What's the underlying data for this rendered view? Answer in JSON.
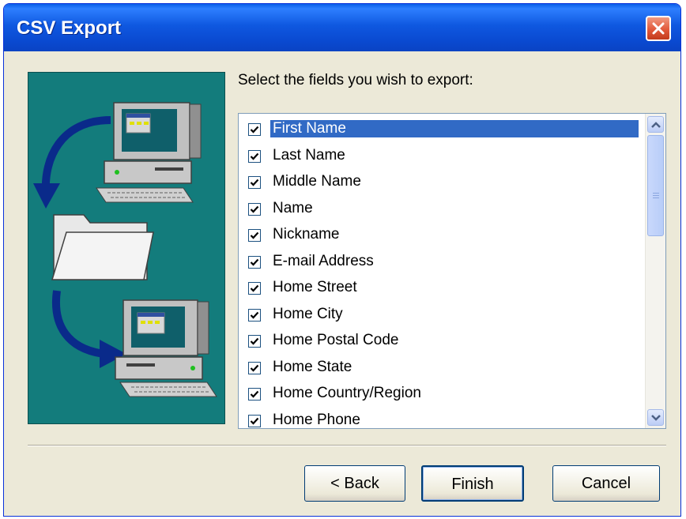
{
  "window": {
    "title": "CSV Export",
    "close_icon": "close-icon"
  },
  "prompt": "Select the fields you wish to export:",
  "fields": [
    {
      "label": "First Name",
      "checked": true,
      "selected": true
    },
    {
      "label": "Last Name",
      "checked": true,
      "selected": false
    },
    {
      "label": "Middle Name",
      "checked": true,
      "selected": false
    },
    {
      "label": "Name",
      "checked": true,
      "selected": false
    },
    {
      "label": "Nickname",
      "checked": true,
      "selected": false
    },
    {
      "label": "E-mail Address",
      "checked": true,
      "selected": false
    },
    {
      "label": "Home Street",
      "checked": true,
      "selected": false
    },
    {
      "label": "Home City",
      "checked": true,
      "selected": false
    },
    {
      "label": "Home Postal Code",
      "checked": true,
      "selected": false
    },
    {
      "label": "Home State",
      "checked": true,
      "selected": false
    },
    {
      "label": "Home Country/Region",
      "checked": true,
      "selected": false
    },
    {
      "label": "Home Phone",
      "checked": true,
      "selected": false
    }
  ],
  "buttons": {
    "back": "< Back",
    "finish": "Finish",
    "cancel": "Cancel"
  },
  "colors": {
    "titlebar": "#0a49d0",
    "selection": "#316ac5",
    "art_background": "#137c7c",
    "close_button": "#e2593b"
  }
}
